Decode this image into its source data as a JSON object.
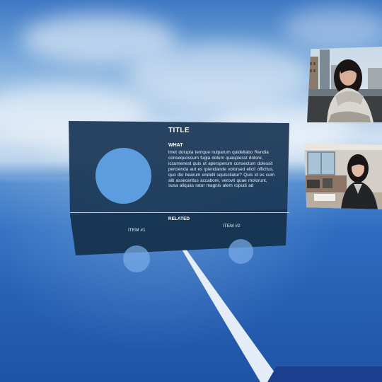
{
  "panel": {
    "title": "TITLE",
    "what_heading": "WHAT",
    "what_body": "lmet dolupta temque nulparum quidellabo Rendia consequossum fugia dolum quaspiesst dolore, iccumenest quis ut apersperum consectum dolessit percienda aut es ipiendande volorsed elicit officitus, quo dio bearum endelli squiscilatur? Quis id es cum alit asseceritus accabore, verovit quae molorunt, susa aliquas ratur magnis atem ropudi ad",
    "related_heading": "RELATED",
    "related_items": [
      {
        "label": "ITEM #1"
      },
      {
        "label": "ITEM #2"
      }
    ]
  },
  "photos": [
    {
      "subject": "woman-in-scarf-city-photo"
    },
    {
      "subject": "woman-in-office-photo"
    }
  ],
  "colors": {
    "panel_bg": "#1d3a58",
    "panel_bottom_bg": "#16334f",
    "placeholder_circle": "#5b9ddf",
    "ray": "#eef4fb",
    "sky_top": "#3f78c4",
    "floor": "#2760b3"
  }
}
